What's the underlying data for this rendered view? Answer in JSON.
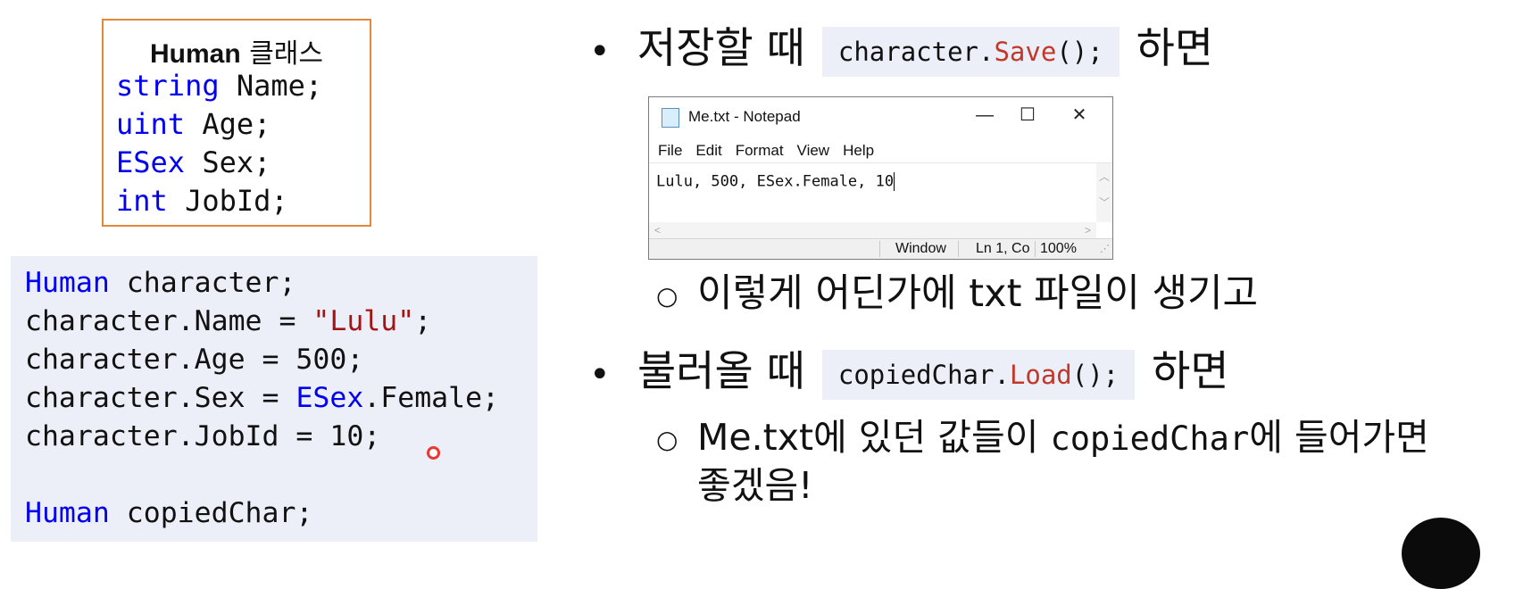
{
  "class_box": {
    "title_bold": "Human",
    "title_rest": " 클래스",
    "fields": [
      {
        "type": "string",
        "name": " Name;"
      },
      {
        "type": "uint",
        "name": " Age;"
      },
      {
        "type": "ESex",
        "name": " Sex;"
      },
      {
        "type": "int",
        "name": " JobId;"
      }
    ]
  },
  "code_block": {
    "line1_type": "Human",
    "line1_rest": " character;",
    "line2_a": "character.Name = ",
    "line2_str": "\"Lulu\"",
    "line2_end": ";",
    "line3": "character.Age = 500;",
    "line4_a": "character.Sex = ",
    "line4_type": "ESex",
    "line4_end": ".Female;",
    "line5": "character.JobId = 10;",
    "line7_type": "Human",
    "line7_rest": " copiedChar;"
  },
  "bullets": {
    "save_prefix": "저장할 때",
    "save_code_obj": "character.",
    "save_code_method": "Save",
    "save_code_end": "();",
    "save_suffix": "하면",
    "sub1": "이렇게 어딘가에 txt 파일이 생기고",
    "load_prefix": "불러올 때",
    "load_code_obj": "copiedChar.",
    "load_code_method": "Load",
    "load_code_end": "();",
    "load_suffix": "하면",
    "sub2_a": "Me.txt에 있던 값들이 ",
    "sub2_code": "copiedChar",
    "sub2_b": "에 들어가면",
    "sub2_line2": "좋겠음!"
  },
  "notepad": {
    "title": "Me.txt - Notepad",
    "menu": [
      "File",
      "Edit",
      "Format",
      "View",
      "Help"
    ],
    "content": "Lulu, 500, ESex.Female, 10",
    "status_window": "Window",
    "status_pos": "Ln 1, Co",
    "status_zoom": "100%"
  }
}
